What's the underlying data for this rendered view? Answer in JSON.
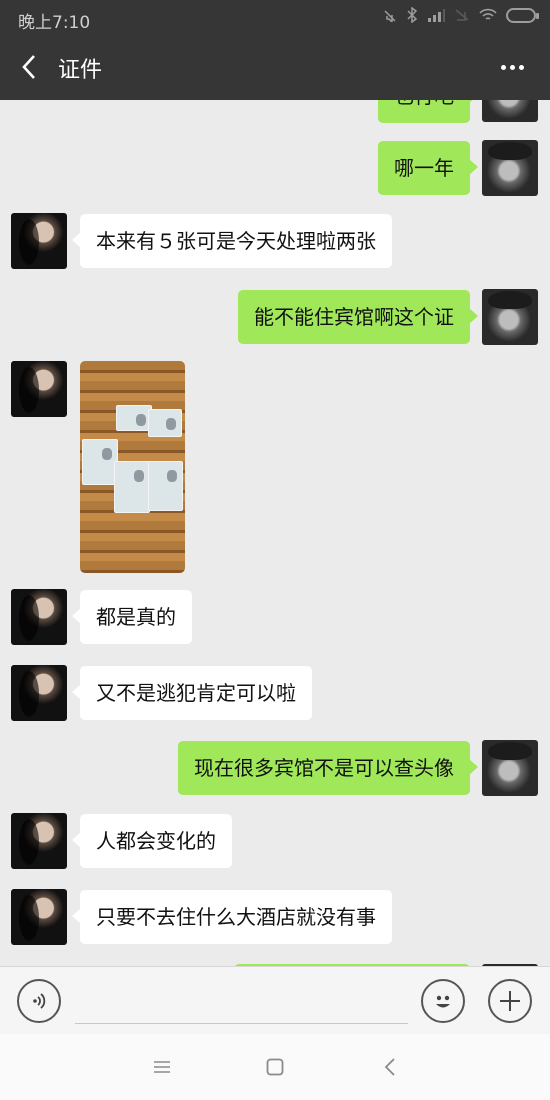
{
  "status_bar": {
    "time": "晚上7:10",
    "icons": [
      "mute-icon",
      "bluetooth-icon",
      "signal-icon",
      "no-sim-icon",
      "wifi-icon",
      "battery-charging-icon"
    ]
  },
  "header": {
    "title": "证件",
    "back_icon": "chevron-left-icon",
    "more_icon": "more-dots-icon"
  },
  "messages": [
    {
      "side": "out",
      "type": "text",
      "text": "也行吧"
    },
    {
      "side": "out",
      "type": "text",
      "text": "哪一年"
    },
    {
      "side": "in",
      "type": "text",
      "text": "本来有５张可是今天处理啦两张"
    },
    {
      "side": "out",
      "type": "text",
      "text": "能不能住宾馆啊这个证"
    },
    {
      "side": "in",
      "type": "image",
      "text": "",
      "description": "photo of several ID cards on a bamboo mat"
    },
    {
      "side": "in",
      "type": "text",
      "text": "都是真的"
    },
    {
      "side": "in",
      "type": "text",
      "text": "又不是逃犯肯定可以啦"
    },
    {
      "side": "out",
      "type": "text",
      "text": "现在很多宾馆不是可以查头像"
    },
    {
      "side": "in",
      "type": "text",
      "text": "人都会变化的"
    },
    {
      "side": "in",
      "type": "text",
      "text": "只要不去住什么大酒店就没有事"
    }
  ],
  "input_bar": {
    "voice_icon": "voice-icon",
    "emoji_icon": "emoji-icon",
    "plus_icon": "plus-icon",
    "text_value": ""
  },
  "system_nav": {
    "icons": [
      "menu-icon",
      "home-icon",
      "back-icon"
    ]
  },
  "colors": {
    "header_bg": "#363636",
    "chat_bg": "#ebebeb",
    "outgoing_bubble": "#a0e75a",
    "incoming_bubble": "#ffffff"
  }
}
